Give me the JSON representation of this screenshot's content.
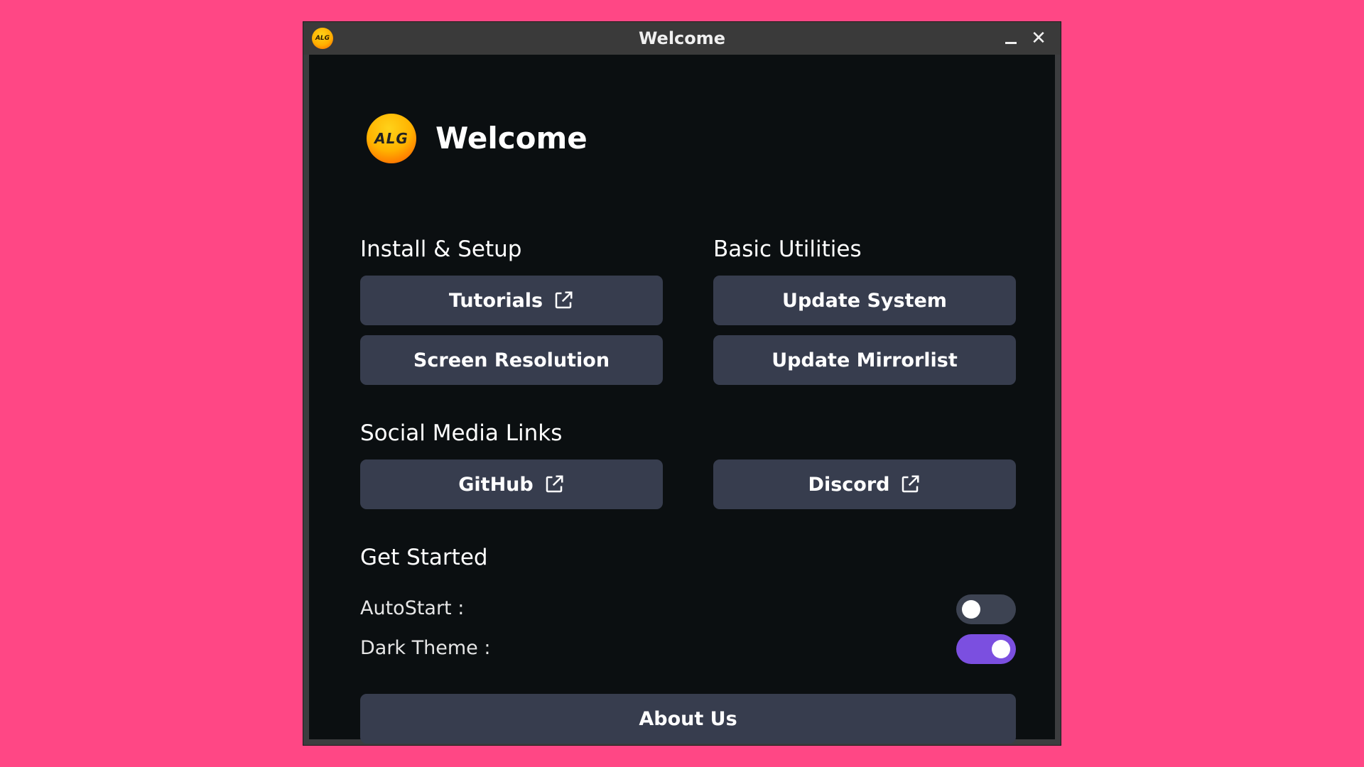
{
  "window": {
    "title": "Welcome",
    "logo_text": "ALG"
  },
  "header": {
    "logo_text": "ALG",
    "title": "Welcome"
  },
  "install_setup": {
    "title": "Install & Setup",
    "tutorials_label": "Tutorials",
    "screen_resolution_label": "Screen Resolution"
  },
  "basic_utilities": {
    "title": "Basic Utilities",
    "update_system_label": "Update System",
    "update_mirrorlist_label": "Update Mirrorlist"
  },
  "social_media": {
    "title": "Social Media Links",
    "github_label": "GitHub",
    "discord_label": "Discord"
  },
  "get_started": {
    "title": "Get Started",
    "autostart_label": "AutoStart :",
    "autostart_on": false,
    "dark_theme_label": "Dark Theme :",
    "dark_theme_on": true
  },
  "about_label": "About Us",
  "colors": {
    "background": "#ff4785",
    "button": "#373d4e",
    "toggle_on": "#7b4fe0",
    "toggle_off": "#3d4352"
  },
  "icons": {
    "external_link": "external-link-icon",
    "minimize": "minimize-icon",
    "close": "close-icon"
  }
}
